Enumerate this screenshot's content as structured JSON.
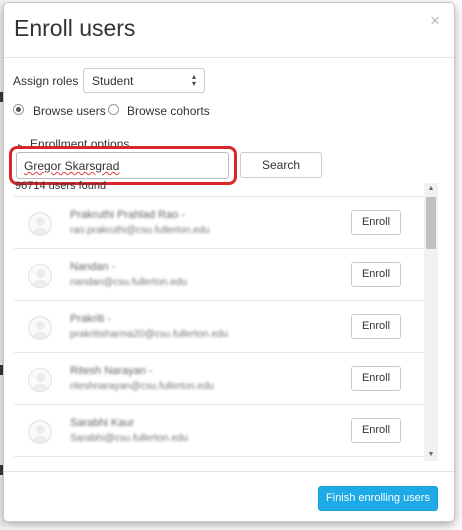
{
  "dialog": {
    "title": "Enroll users",
    "close_glyph": "×",
    "close_icon": "close-icon"
  },
  "assign_roles": {
    "label": "Assign roles",
    "selected": "Student",
    "caret_glyph": "▴\n▾"
  },
  "browse": {
    "users_label": "Browse users",
    "users_selected": true,
    "cohorts_label": "Browse cohorts",
    "cohorts_selected": false
  },
  "enrollment_options": {
    "label": "Enrollment options",
    "toggle_glyph": "▸"
  },
  "search": {
    "value": "Gregor Skarsgrad",
    "button_label": "Search",
    "highlight_color": "#d9262b"
  },
  "results": {
    "count_text": "96714 users found"
  },
  "users": [
    {
      "name": "Prakruthi Prahlad Rao -",
      "email": "rao.prakruthi@csu.fullerton.edu",
      "enroll_label": "Enroll"
    },
    {
      "name": "Nandan -",
      "email": "nandan@csu.fullerton.edu",
      "enroll_label": "Enroll"
    },
    {
      "name": "Prakriti -",
      "email": "prakritisharma20@csu.fullerton.edu",
      "enroll_label": "Enroll"
    },
    {
      "name": "Ritesh Narayan -",
      "email": "riteshnarayan@csu.fullerton.edu",
      "enroll_label": "Enroll"
    },
    {
      "name": "Sarabhi Kaur",
      "email": "Sarabhi@csu.fullerton.edu",
      "enroll_label": "Enroll"
    }
  ],
  "scrollbar": {
    "up_glyph": "▲",
    "down_glyph": "▼"
  },
  "footer": {
    "finish_label": "Finish enrolling users"
  },
  "colors": {
    "accent": "#1eaae7",
    "highlight": "#d9262b"
  }
}
